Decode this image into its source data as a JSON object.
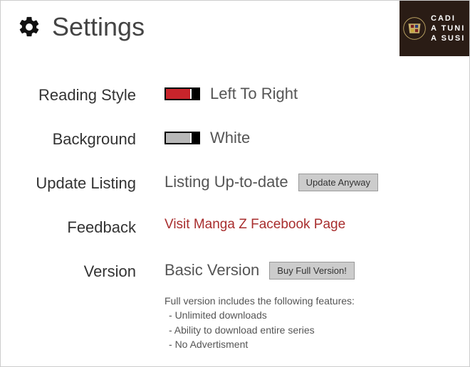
{
  "header": {
    "title": "Settings"
  },
  "ad": {
    "line1": "CADI",
    "line2": "A TUNI",
    "line3": "A SUSI"
  },
  "settings": {
    "readingStyle": {
      "label": "Reading Style",
      "value": "Left To Right"
    },
    "background": {
      "label": "Background",
      "value": "White"
    },
    "updateListing": {
      "label": "Update Listing",
      "status": "Listing Up-to-date",
      "button": "Update Anyway"
    },
    "feedback": {
      "label": "Feedback",
      "linkText": "Visit Manga Z Facebook Page"
    },
    "version": {
      "label": "Version",
      "value": "Basic Version",
      "button": "Buy Full Version!",
      "featuresHeading": "Full version includes the following features:",
      "features": {
        "0": "Unlimited downloads",
        "1": "Ability to download entire series",
        "2": "No Advertisment"
      }
    }
  }
}
